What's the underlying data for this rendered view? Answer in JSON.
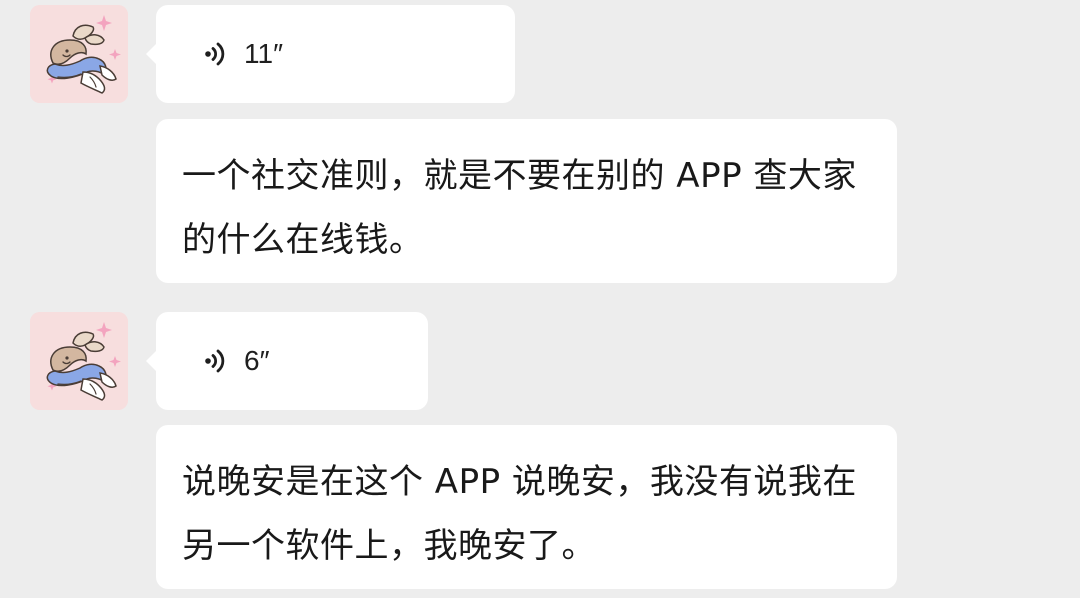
{
  "messages": [
    {
      "type": "voice",
      "duration": "11″"
    },
    {
      "type": "text",
      "text": "一个社交准则，就是不要在别的 APP 查大家的什么在线钱。"
    },
    {
      "type": "voice",
      "duration": "6″"
    },
    {
      "type": "text",
      "text": "说晚安是在这个 APP 说晚安，我没有说我在另一个软件上，我晚安了。"
    }
  ],
  "colors": {
    "background": "#ededed",
    "bubble": "#ffffff",
    "text": "#191919",
    "avatar_bg": "#f7dede",
    "sparkle": "#f3a4bf"
  },
  "icons": {
    "voice": "sound-wave-icon",
    "avatar": "bunny-avatar-icon"
  }
}
